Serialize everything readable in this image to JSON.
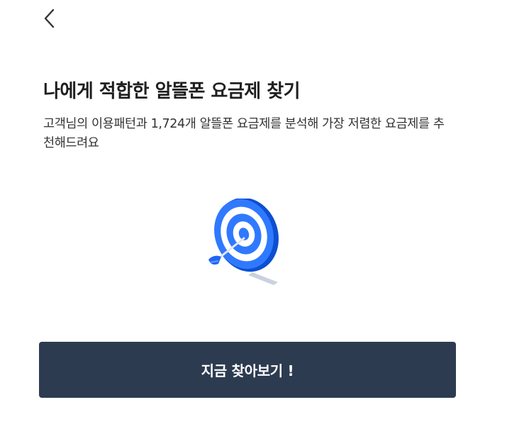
{
  "header": {
    "back_icon": "chevron-left-icon"
  },
  "main": {
    "title": "나에게 적합한 알뜰폰 요금제 찾기",
    "description": "고객님의 이용패턴과 1,724개 알뜰폰 요금제를 분석해 가장 저렴한 요금제를 추천해드려요",
    "illustration_icon": "target-with-arrow-icon"
  },
  "cta": {
    "label": "지금 찾아보기 !"
  },
  "colors": {
    "cta_background": "#2d3b51",
    "target_blue": "#1f66f2",
    "text_primary": "#1f1f1f"
  }
}
